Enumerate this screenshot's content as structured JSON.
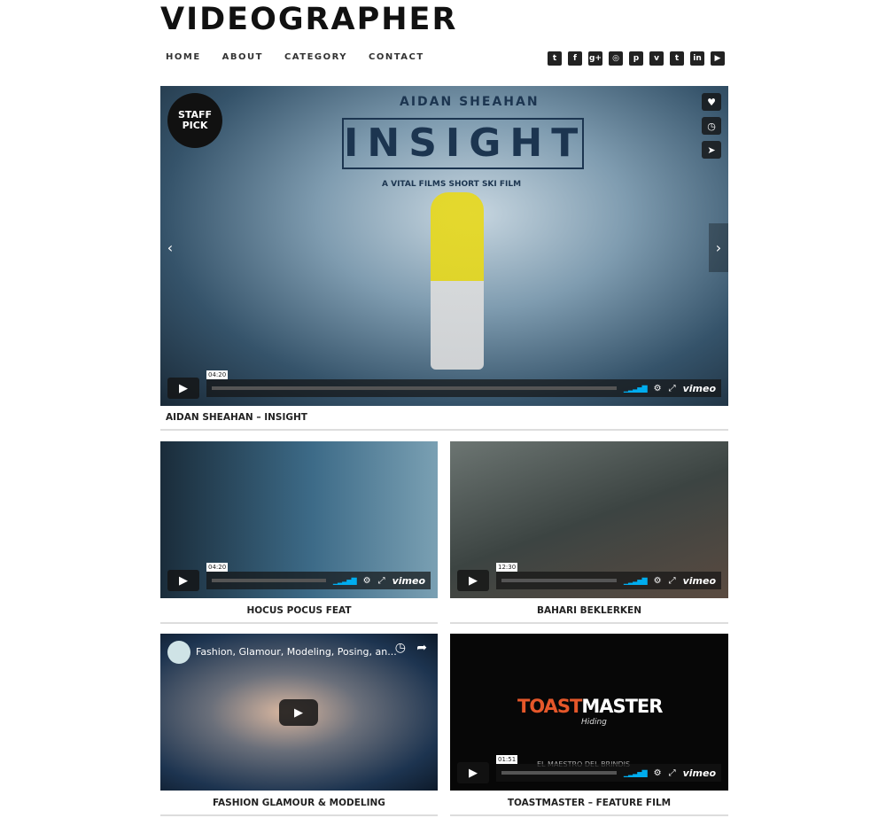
{
  "site": {
    "logo": "VIDEOGRAPHER"
  },
  "nav": [
    {
      "label": "HOME"
    },
    {
      "label": "ABOUT"
    },
    {
      "label": "CATEGORY"
    },
    {
      "label": "CONTACT"
    }
  ],
  "social": [
    {
      "icon": "twitter-icon",
      "glyph": "t"
    },
    {
      "icon": "facebook-icon",
      "glyph": "f"
    },
    {
      "icon": "google-plus-icon",
      "glyph": "g+"
    },
    {
      "icon": "instagram-icon",
      "glyph": "◎"
    },
    {
      "icon": "pinterest-icon",
      "glyph": "p"
    },
    {
      "icon": "vimeo-icon",
      "glyph": "v"
    },
    {
      "icon": "tumblr-icon",
      "glyph": "t"
    },
    {
      "icon": "linkedin-icon",
      "glyph": "in"
    },
    {
      "icon": "youtube-icon",
      "glyph": "▶"
    }
  ],
  "hero": {
    "badge": "STAFF PICK",
    "subtitle_top": "AIDAN SHEAHAN",
    "film_title": "INSIGHT",
    "tagline": "A VITAL FILMS SHORT SKI FILM",
    "time": "04:20",
    "brand": "vimeo",
    "caption": "AIDAN SHEAHAN – INSIGHT"
  },
  "cards": [
    {
      "caption": "HOCUS POCUS FEAT",
      "time": "04:20",
      "brand": "vimeo"
    },
    {
      "caption": "BAHARI BEKLERKEN",
      "time": "12:30",
      "brand": "vimeo"
    },
    {
      "caption": "FASHION GLAMOUR & MODELING",
      "yt_title": "Fashion, Glamour, Modeling, Posing, an..."
    },
    {
      "caption": "TOASTMASTER – FEATURE FILM",
      "time": "01:51",
      "brand": "vimeo",
      "logo_a": "TOAST",
      "logo_b": "MASTER",
      "logo_sub": "Hiding",
      "subtitle": "EL MAESTRO DEL BRINDIS"
    }
  ]
}
